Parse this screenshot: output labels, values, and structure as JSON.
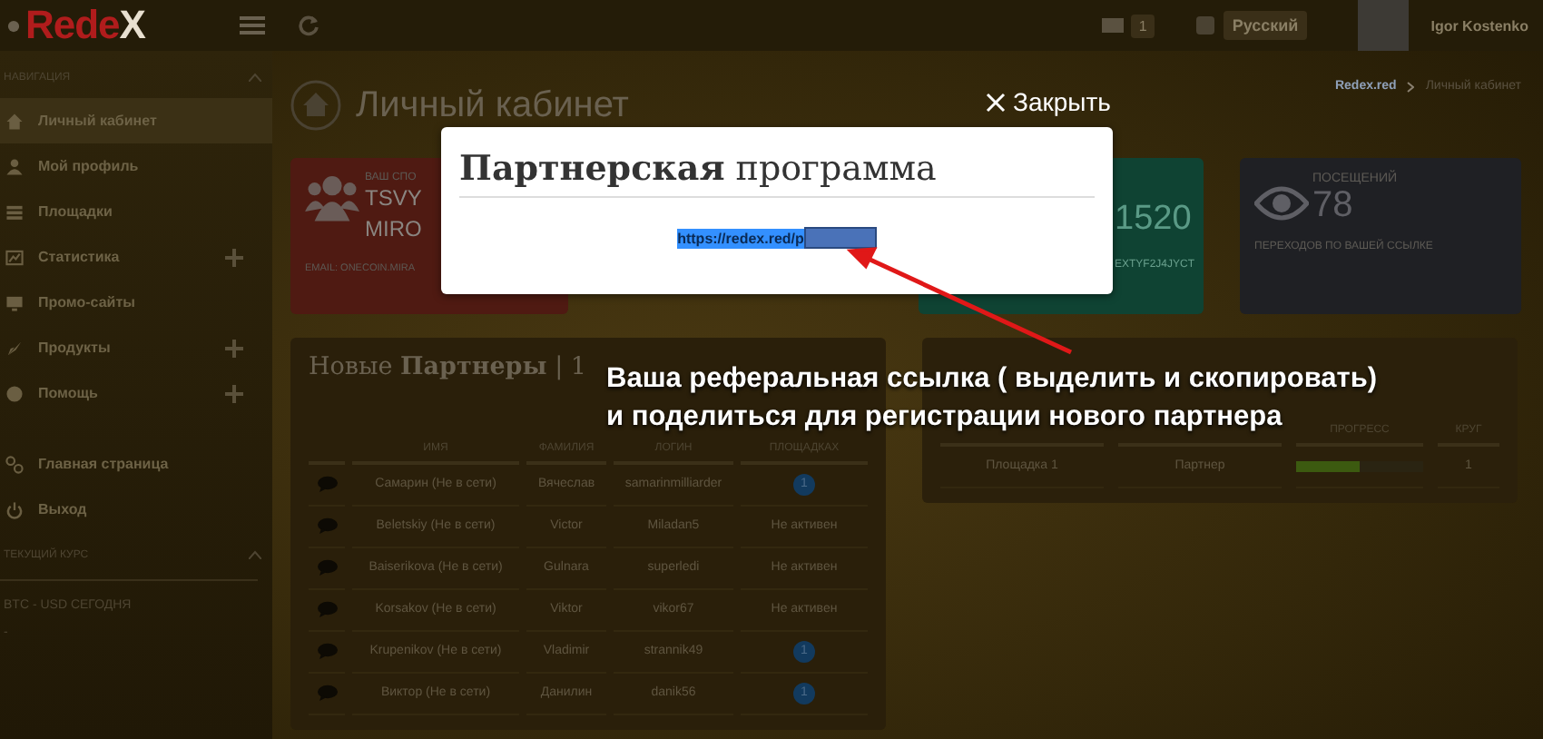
{
  "header": {
    "logo_main": "Rede",
    "logo_accent": "X",
    "messages_badge": "1",
    "language": "Русский",
    "user_name": "Igor Kostenko"
  },
  "sidebar": {
    "nav_title": "НАВИГАЦИЯ",
    "items": [
      {
        "label": "Личный кабинет",
        "selected": true,
        "expandable": false
      },
      {
        "label": "Мой профиль",
        "selected": false,
        "expandable": false
      },
      {
        "label": "Площадки",
        "selected": false,
        "expandable": false
      },
      {
        "label": "Статистика",
        "selected": false,
        "expandable": true
      },
      {
        "label": "Промо-сайты",
        "selected": false,
        "expandable": false
      },
      {
        "label": "Продукты",
        "selected": false,
        "expandable": true
      },
      {
        "label": "Помощь",
        "selected": false,
        "expandable": true
      }
    ],
    "bottom_items": [
      {
        "label": "Главная страница",
        "selected": false
      },
      {
        "label": "Выход",
        "selected": false
      }
    ],
    "rate_title": "ТЕКУЩИЙ КУРС",
    "rate_label": "BTC - USD СЕГОДНЯ",
    "rate_value": "-"
  },
  "page": {
    "title": "Личный кабинет",
    "breadcrumb": [
      "Redex.red",
      "Личный кабинет"
    ]
  },
  "sponsor_card": {
    "label": "ВАШ СПО",
    "name_lines": [
      "TSVY",
      "MIRO"
    ],
    "email": "EMAIL: ONECOIN.MIRA"
  },
  "code_card": {
    "number": "1520",
    "code": "EXTYF2J4JYCT"
  },
  "visits_card": {
    "label": "ПОСЕЩЕНИЙ",
    "value": "78",
    "caption": "ПЕРЕХОДОВ ПО ВАШЕЙ ССЫЛКЕ"
  },
  "partners": {
    "title": "Новые **Партнеры** | 1",
    "columns": [
      "ИМЯ",
      "ФАМИЛИЯ",
      "ЛОГИН",
      "ПЛОЩАДКАХ"
    ],
    "rows": [
      {
        "cells": [
          "Самарин (Не в сети)",
          "Вячеслав",
          "samarinmilliarder"
        ],
        "status": {
          "kind": "badge",
          "text": "1"
        }
      },
      {
        "cells": [
          "Beletskiy (Не в сети)",
          "Victor",
          "Miladan5"
        ],
        "status": {
          "kind": "text",
          "text": "Не активен"
        }
      },
      {
        "cells": [
          "Baiserikova (Не в сети)",
          "Gulnara",
          "superledi"
        ],
        "status": {
          "kind": "text",
          "text": "Не активен"
        }
      },
      {
        "cells": [
          "Korsakov (Не в сети)",
          "Viktor",
          "vikor67"
        ],
        "status": {
          "kind": "text",
          "text": "Не активен"
        }
      },
      {
        "cells": [
          "Krupenikov (Не в сети)",
          "Vladimir",
          "strannik49"
        ],
        "status": {
          "kind": "badge",
          "text": "1"
        }
      },
      {
        "cells": [
          "Виктор (Не в сети)",
          "Данилин",
          "danik56"
        ],
        "status": {
          "kind": "badge",
          "text": "1"
        }
      }
    ]
  },
  "progress": {
    "columns": [
      "ПРОГРЕСС",
      "КРУГ"
    ],
    "rows": [
      {
        "site": "Площадка 1",
        "position": "Партнер",
        "level": 0.5,
        "round": "1"
      }
    ]
  },
  "modal": {
    "close": "Закрыть",
    "title": "**Партнерская** программа",
    "link": "https://redex.red/p"
  },
  "annotation": {
    "lines": [
      "Ваша реферальная ссылка ( выделить и скопировать)",
      "и поделиться  для регистрации нового партнера"
    ]
  }
}
